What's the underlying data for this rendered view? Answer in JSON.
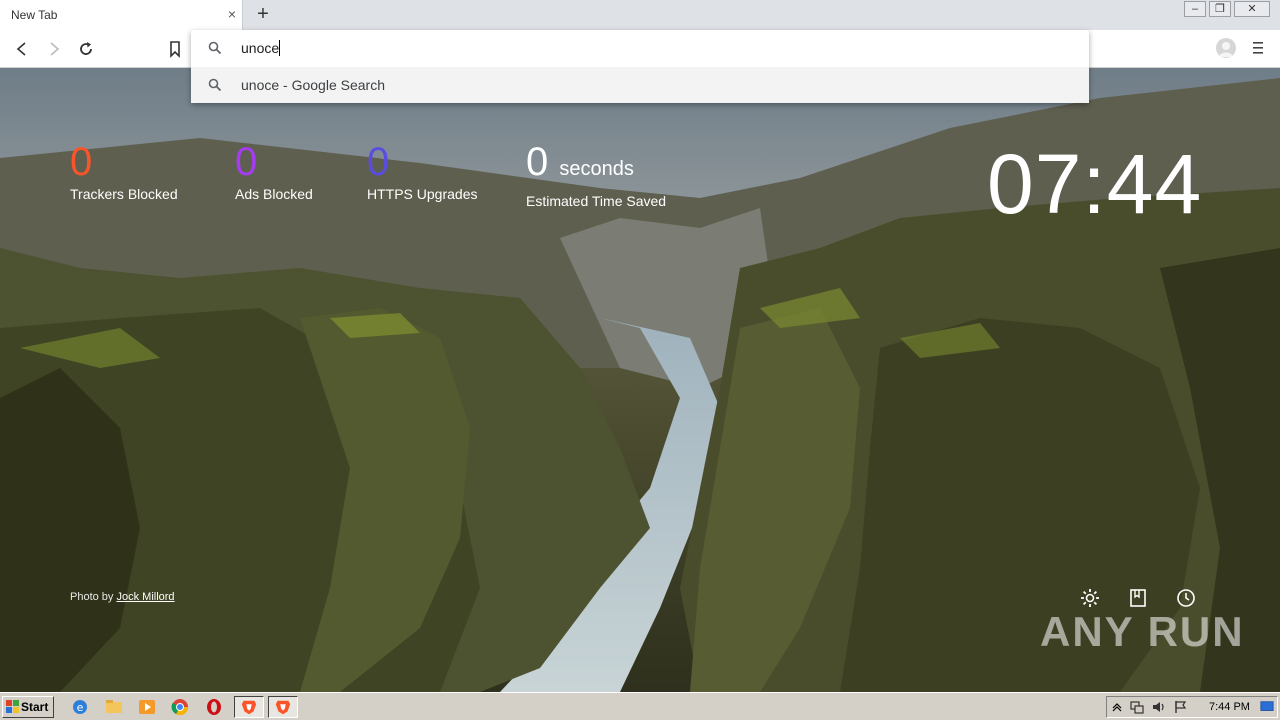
{
  "tab": {
    "title": "New Tab"
  },
  "omnibox": {
    "input_value": "unoce",
    "suggestion": "unoce - Google Search"
  },
  "stats": [
    {
      "value": "0",
      "label": "Trackers Blocked",
      "color": "#fb542b"
    },
    {
      "value": "0",
      "label": "Ads Blocked",
      "color": "#a53cf0"
    },
    {
      "value": "0",
      "label": "HTTPS Upgrades",
      "color": "#5a4de0"
    },
    {
      "value": "0",
      "unit": "seconds",
      "label": "Estimated Time Saved",
      "color": "#ffffff"
    }
  ],
  "clock": "07:44",
  "credit": {
    "prefix": "Photo by",
    "author": "Jock Millord"
  },
  "watermark": "ANY RUN",
  "taskbar": {
    "start_label": "Start",
    "time": "7:44 PM"
  }
}
